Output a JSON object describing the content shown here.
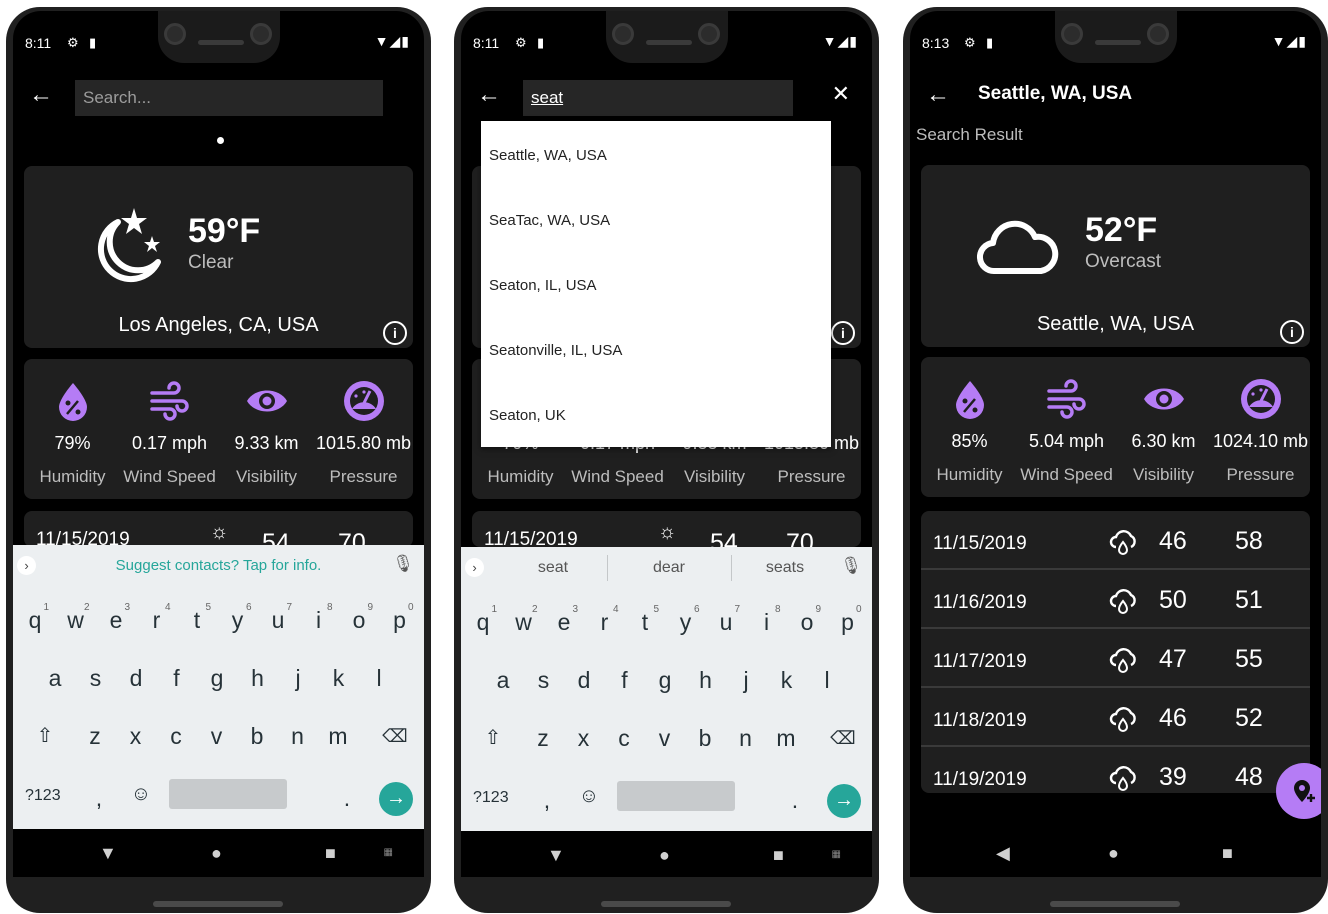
{
  "colors": {
    "accent": "#b57cf5",
    "keyboard_accent": "#26a69a",
    "card": "#1f1f1f"
  },
  "screen1": {
    "status_time": "8:11",
    "search_placeholder": "Search...",
    "current": {
      "temp": "59°F",
      "desc": "Clear",
      "location": "Los Angeles, CA, USA",
      "icon": "moon-stars-icon"
    },
    "stats": [
      {
        "value": "79%",
        "label": "Humidity",
        "icon": "humidity-icon"
      },
      {
        "value": "0.17 mph",
        "label": "Wind Speed",
        "icon": "wind-icon"
      },
      {
        "value": "9.33 km",
        "label": "Visibility",
        "icon": "eye-icon"
      },
      {
        "value": "1015.80 mb",
        "label": "Pressure",
        "icon": "gauge-icon"
      }
    ],
    "peek": {
      "date": "11/15/2019",
      "lo": "54",
      "hi": "70"
    },
    "keyboard_hint": "Suggest contacts? Tap for info."
  },
  "screen2": {
    "status_time": "8:11",
    "search_value": "seat",
    "suggestions": [
      "Seattle, WA, USA",
      "SeaTac, WA, USA",
      "Seaton, IL, USA",
      "Seatonville, IL, USA",
      "Seaton, UK"
    ],
    "peek_values": {
      "v1": "79%",
      "v2": "0.17 mph",
      "v3": "9.33 km",
      "v4": "1015.80 mb"
    },
    "stat_labels": [
      "Humidity",
      "Wind Speed",
      "Visibility",
      "Pressure"
    ],
    "peek": {
      "date": "11/15/2019",
      "lo": "54",
      "hi": "70"
    },
    "word_suggestions": [
      "seat",
      "dear",
      "seats"
    ]
  },
  "screen3": {
    "status_time": "8:13",
    "title": "Seattle, WA, USA",
    "subtitle": "Search Result",
    "current": {
      "temp": "52°F",
      "desc": "Overcast",
      "location": "Seattle, WA, USA",
      "icon": "cloud-icon"
    },
    "stats": [
      {
        "value": "85%",
        "label": "Humidity",
        "icon": "humidity-icon"
      },
      {
        "value": "5.04 mph",
        "label": "Wind Speed",
        "icon": "wind-icon"
      },
      {
        "value": "6.30 km",
        "label": "Visibility",
        "icon": "eye-icon"
      },
      {
        "value": "1024.10 mb",
        "label": "Pressure",
        "icon": "gauge-icon"
      }
    ],
    "forecast": [
      {
        "date": "11/15/2019",
        "lo": "46",
        "hi": "58"
      },
      {
        "date": "11/16/2019",
        "lo": "50",
        "hi": "51"
      },
      {
        "date": "11/17/2019",
        "lo": "47",
        "hi": "55"
      },
      {
        "date": "11/18/2019",
        "lo": "46",
        "hi": "52"
      },
      {
        "date": "11/19/2019",
        "lo": "39",
        "hi": "48"
      }
    ]
  },
  "keyboard": {
    "row1": [
      "q",
      "w",
      "e",
      "r",
      "t",
      "y",
      "u",
      "i",
      "o",
      "p"
    ],
    "row1_nums": [
      "1",
      "2",
      "3",
      "4",
      "5",
      "6",
      "7",
      "8",
      "9",
      "0"
    ],
    "row2": [
      "a",
      "s",
      "d",
      "f",
      "g",
      "h",
      "j",
      "k",
      "l"
    ],
    "row3": [
      "z",
      "x",
      "c",
      "v",
      "b",
      "n",
      "m"
    ],
    "symbols_label": "?123",
    "comma": ",",
    "period": "."
  }
}
